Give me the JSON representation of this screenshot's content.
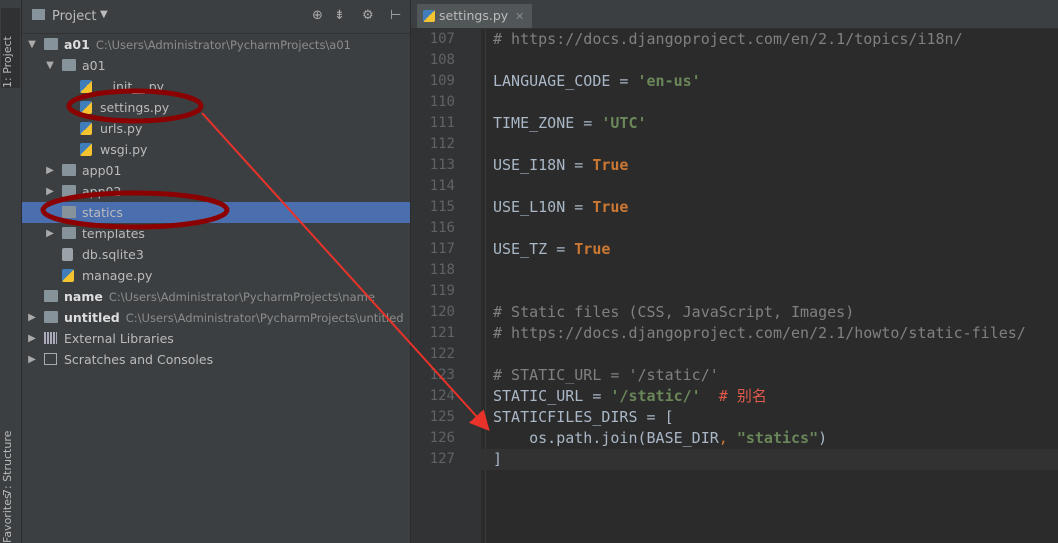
{
  "side_tabs": {
    "project": "1: Project",
    "structure": "7: Structure",
    "favorites": "Favorites"
  },
  "project_panel": {
    "title": "Project",
    "tree": [
      {
        "label": "a01",
        "path": "C:\\Users\\Administrator\\PycharmProjects\\a01",
        "bold": true,
        "level": 0,
        "expanded": true,
        "kind": "folder"
      },
      {
        "label": "a01",
        "level": 1,
        "expanded": true,
        "kind": "folder"
      },
      {
        "label": "__init__.py",
        "level": 2,
        "kind": "py"
      },
      {
        "label": "settings.py",
        "level": 2,
        "kind": "py"
      },
      {
        "label": "urls.py",
        "level": 2,
        "kind": "py"
      },
      {
        "label": "wsgi.py",
        "level": 2,
        "kind": "py"
      },
      {
        "label": "app01",
        "level": 1,
        "expanded": false,
        "kind": "folder"
      },
      {
        "label": "app02",
        "level": 1,
        "expanded": false,
        "kind": "folder"
      },
      {
        "label": "statics",
        "level": 1,
        "kind": "folder",
        "selected": true
      },
      {
        "label": "templates",
        "level": 1,
        "expanded": false,
        "kind": "folder"
      },
      {
        "label": "db.sqlite3",
        "level": 1,
        "kind": "db"
      },
      {
        "label": "manage.py",
        "level": 1,
        "kind": "py"
      },
      {
        "label": "name",
        "path": "C:\\Users\\Administrator\\PycharmProjects\\name",
        "bold": true,
        "level": 0,
        "kind": "folder"
      },
      {
        "label": "untitled",
        "path": "C:\\Users\\Administrator\\PycharmProjects\\untitled",
        "bold": true,
        "level": 0,
        "expanded": false,
        "kind": "folder"
      },
      {
        "label": "External Libraries",
        "level": 0,
        "expanded": false,
        "kind": "lib"
      },
      {
        "label": "Scratches and Consoles",
        "level": 0,
        "expanded": false,
        "kind": "scratch"
      }
    ]
  },
  "editor": {
    "tab": "settings.py",
    "lines": [
      {
        "n": "107",
        "html": "<span class='c-com'># https://docs.djangoproject.com/en/2.1/topics/i18n/</span>"
      },
      {
        "n": "108",
        "html": ""
      },
      {
        "n": "109",
        "html": "LANGUAGE_CODE = <span class='c-str'>'en-us'</span>"
      },
      {
        "n": "110",
        "html": ""
      },
      {
        "n": "111",
        "html": "TIME_ZONE = <span class='c-str'>'UTC'</span>"
      },
      {
        "n": "112",
        "html": ""
      },
      {
        "n": "113",
        "html": "USE_I18N = <span class='c-kw'>True</span>"
      },
      {
        "n": "114",
        "html": ""
      },
      {
        "n": "115",
        "html": "USE_L10N = <span class='c-kw'>True</span>"
      },
      {
        "n": "116",
        "html": ""
      },
      {
        "n": "117",
        "html": "USE_TZ = <span class='c-kw'>True</span>"
      },
      {
        "n": "118",
        "html": ""
      },
      {
        "n": "119",
        "html": ""
      },
      {
        "n": "120",
        "html": "<span class='c-com'># Static files (CSS, JavaScript, Images)</span>"
      },
      {
        "n": "121",
        "html": "<span class='c-com'># https://docs.djangoproject.com/en/2.1/howto/static-files/</span>"
      },
      {
        "n": "122",
        "html": ""
      },
      {
        "n": "123",
        "html": "<span class='c-com'># STATIC_URL = '/static/'</span>"
      },
      {
        "n": "124",
        "html": "STATIC_URL = <span class='c-str'>'/static/'</span>  <span class='c-red'># 别名</span>"
      },
      {
        "n": "125",
        "html": "STATICFILES_DIRS = ["
      },
      {
        "n": "126",
        "html": "    os.path.join(BASE_DIR<span class='c-cn'>,</span> <span class='c-str'>\"statics\"</span>)"
      },
      {
        "n": "127",
        "html": "]"
      }
    ]
  },
  "colors": {
    "accent": "#4b6eaf",
    "annotation": "#8b0000",
    "arrow": "#e8322a"
  }
}
